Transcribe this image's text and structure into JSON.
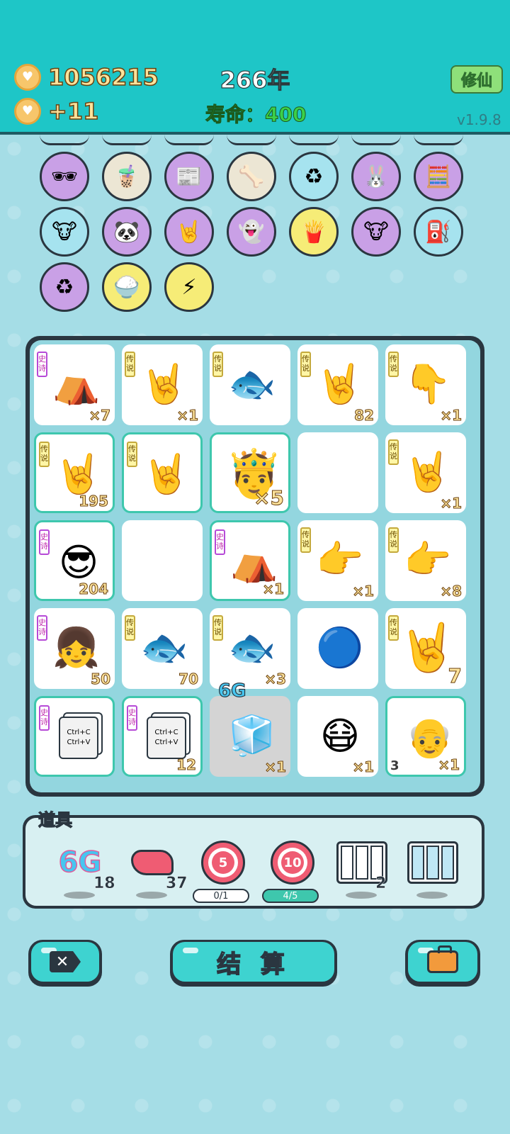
{
  "header": {
    "coins": "1056215",
    "income": "+11",
    "year": "266年",
    "lifespan_label": "寿命：",
    "lifespan_value": "400",
    "xiuxian_button": "修仙",
    "version": "v1.9.8"
  },
  "collection_icons": [
    {
      "icon": "sunglasses-icon",
      "bg": "#c9a0e6"
    },
    {
      "icon": "bubble-tea-icon",
      "bg": "#ece6d4"
    },
    {
      "icon": "time-magazine-icon",
      "bg": "#c9a0e6"
    },
    {
      "icon": "dog-bowl-icon",
      "bg": "#ece6d4"
    },
    {
      "icon": "recycle-bag-icon",
      "bg": "#a6e3ef"
    },
    {
      "icon": "rabbit-icon",
      "bg": "#c9a0e6"
    },
    {
      "icon": "math-guy-icon",
      "bg": "#c9a0e6"
    },
    {
      "icon": "cow-pair-icon",
      "bg": "#a6e3ef"
    },
    {
      "icon": "panda-icon",
      "bg": "#c9a0e6"
    },
    {
      "icon": "rock-hand-icon",
      "bg": "#c9a0e6"
    },
    {
      "icon": "ghost-icon",
      "bg": "#c9a0e6"
    },
    {
      "icon": "fries-icon",
      "bg": "#f6ec77"
    },
    {
      "icon": "cow-pair-icon",
      "bg": "#c9a0e6"
    },
    {
      "icon": "pump-icon",
      "bg": "#a6e3ef"
    },
    {
      "icon": "recycle-icon",
      "bg": "#c9a0e6"
    },
    {
      "icon": "rice-bowl-icon",
      "bg": "#f6ec77"
    },
    {
      "icon": "lightning-icon",
      "bg": "#f6ec77"
    }
  ],
  "board": {
    "rank_legend": "传说",
    "rank_epic": "史诗",
    "cells": [
      {
        "rank": "史诗",
        "item": "tent-icon",
        "glyph": "⛺",
        "qty": "×7",
        "ring": false
      },
      {
        "rank": "传说",
        "item": "rock-hand-icon",
        "glyph": "🤘",
        "qty": "×1",
        "ring": false
      },
      {
        "rank": "传说",
        "item": "fish-icon",
        "glyph": "🐟",
        "qty": "",
        "ring": false
      },
      {
        "rank": "传说",
        "item": "rock-hand-icon",
        "glyph": "🤘",
        "qty": "82",
        "ring": false
      },
      {
        "rank": "传说",
        "item": "point-hand-icon",
        "glyph": "👇",
        "qty": "×1",
        "ring": false
      },
      {
        "rank": "传说",
        "item": "rock-hand-icon",
        "glyph": "🤘",
        "qty": "195",
        "ring": true
      },
      {
        "rank": "传说",
        "item": "rock-hand-icon",
        "glyph": "🤘",
        "qty": "",
        "ring": true
      },
      {
        "rank": "",
        "item": "king-face-icon",
        "glyph": "🤴",
        "qty": "×5",
        "ring": true,
        "big": true
      },
      {
        "rank": "",
        "item": "empty-slot",
        "glyph": "",
        "qty": "",
        "ring": false
      },
      {
        "rank": "传说",
        "item": "rock-hand-icon",
        "glyph": "🤘",
        "qty": "×1",
        "ring": false
      },
      {
        "rank": "史诗",
        "item": "green-hair-face-icon",
        "glyph": "😎",
        "qty": "204",
        "ring": true
      },
      {
        "rank": "",
        "item": "empty-slot",
        "glyph": "",
        "qty": "",
        "ring": false
      },
      {
        "rank": "史诗",
        "item": "rabbit-tent-icon",
        "glyph": "⛺",
        "qty": "×1",
        "ring": true
      },
      {
        "rank": "传说",
        "item": "gun-hand-icon",
        "glyph": "👉",
        "qty": "×1",
        "ring": false
      },
      {
        "rank": "传说",
        "item": "gun-hand-icon",
        "glyph": "👉",
        "qty": "×8",
        "ring": false
      },
      {
        "rank": "史诗",
        "item": "girl-face-icon",
        "glyph": "👧",
        "qty": "50",
        "ring": false
      },
      {
        "rank": "传说",
        "item": "fish-icon",
        "glyph": "🐟",
        "qty": "70",
        "ring": false
      },
      {
        "rank": "传说",
        "item": "fish-icon",
        "glyph": "🐟",
        "qty": "×3",
        "ring": false
      },
      {
        "rank": "",
        "item": "math-ball-icon",
        "glyph": "🔵",
        "qty": "",
        "ring": false
      },
      {
        "rank": "传说",
        "item": "rock-hand-icon",
        "glyph": "🤘",
        "qty": "7",
        "ring": false,
        "big": true
      },
      {
        "rank": "史诗",
        "item": "copy-paste-icon",
        "glyph": "",
        "qty": "",
        "ring": true,
        "text": "Ctrl+C\nCtrl+V"
      },
      {
        "rank": "史诗",
        "item": "copy-paste-icon",
        "glyph": "",
        "qty": "12",
        "ring": true,
        "text": "Ctrl+C\nCtrl+V"
      },
      {
        "rank": "",
        "item": "fridge-icon",
        "glyph": "🧊",
        "qty": "×1",
        "ring": false,
        "grey": true,
        "label": "6G"
      },
      {
        "rank": "",
        "item": "sunglasses-man-icon",
        "glyph": "😷",
        "qty": "×1",
        "ring": false
      },
      {
        "rank": "",
        "item": "old-man-icon",
        "glyph": "👴",
        "qty": "×1",
        "ring": true,
        "left": "3"
      }
    ]
  },
  "tools": {
    "label": "道具",
    "items": [
      {
        "icon": "6g-icon",
        "text": "6G",
        "count": "18"
      },
      {
        "icon": "liver-icon",
        "text": "",
        "count": "37"
      },
      {
        "icon": "target-5-icon",
        "text": "5",
        "progress": "0/1",
        "fill": false
      },
      {
        "icon": "target-10-icon",
        "text": "10",
        "progress": "4/5",
        "fill": true
      },
      {
        "icon": "three-slots-icon",
        "text": "",
        "count": "2"
      },
      {
        "icon": "three-cards-icon",
        "text": "",
        "count": ""
      }
    ]
  },
  "buttons": {
    "close": "close-icon",
    "settle": "结 算",
    "bag": "briefcase-icon"
  }
}
